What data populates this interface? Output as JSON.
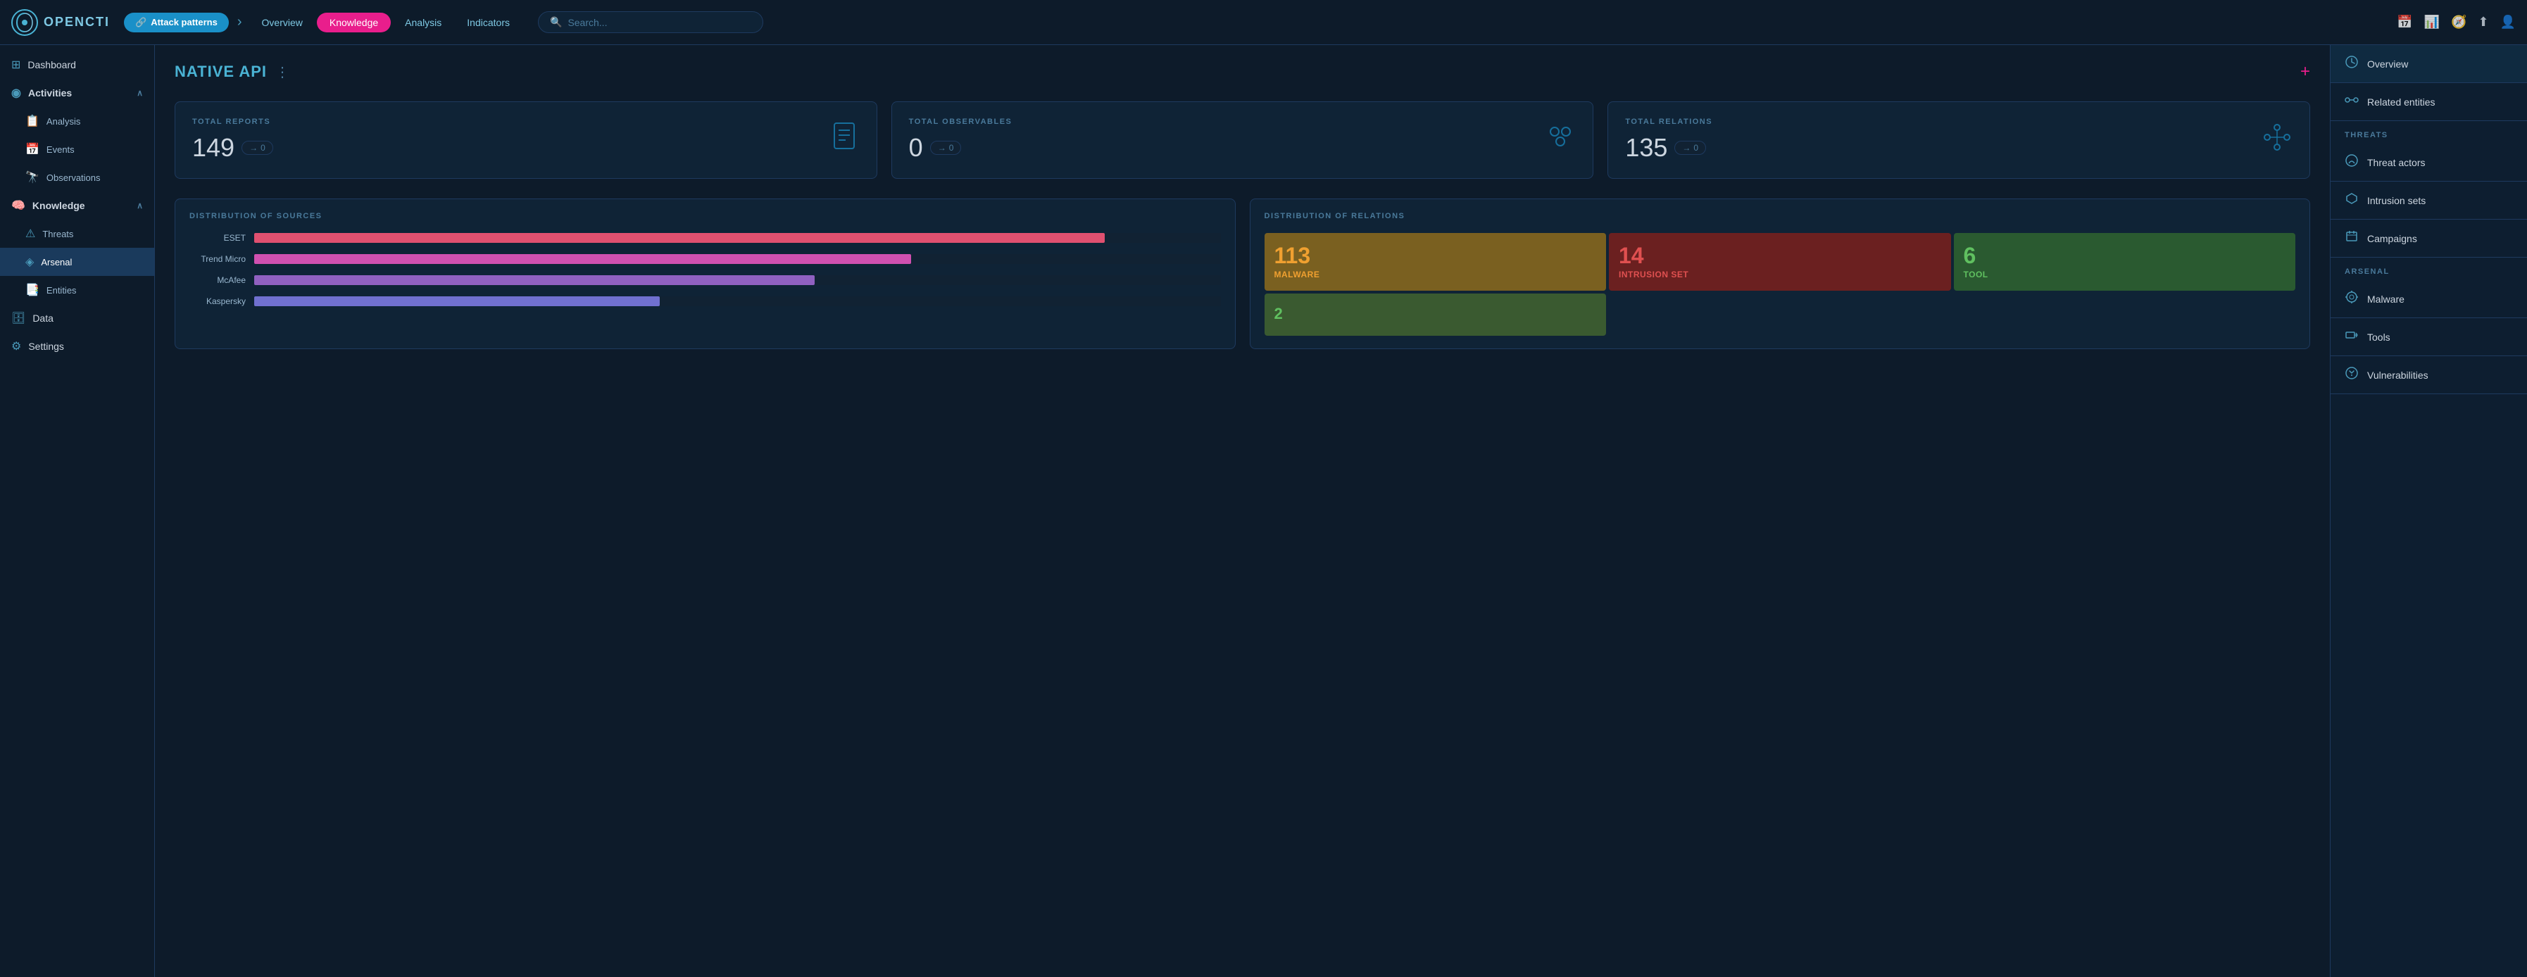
{
  "logo": {
    "text": "OPENCTI"
  },
  "topnav": {
    "breadcrumb_icon": "🔗",
    "breadcrumb_label": "Attack patterns",
    "tabs": [
      {
        "id": "overview",
        "label": "Overview",
        "active": false
      },
      {
        "id": "knowledge",
        "label": "Knowledge",
        "active": true
      },
      {
        "id": "analysis",
        "label": "Analysis",
        "active": false
      },
      {
        "id": "indicators",
        "label": "Indicators",
        "active": false
      }
    ],
    "search_placeholder": "Search...",
    "icons": [
      "📅",
      "📊",
      "🧭",
      "⬆",
      "👤"
    ]
  },
  "sidebar": {
    "items": [
      {
        "id": "dashboard",
        "label": "Dashboard",
        "icon": "⊞",
        "level": "top"
      },
      {
        "id": "activities",
        "label": "Activities",
        "icon": "⚙",
        "level": "top",
        "expanded": true
      },
      {
        "id": "analysis",
        "label": "Analysis",
        "icon": "📋",
        "level": "sub"
      },
      {
        "id": "events",
        "label": "Events",
        "icon": "📅",
        "level": "sub"
      },
      {
        "id": "observations",
        "label": "Observations",
        "icon": "🔭",
        "level": "sub"
      },
      {
        "id": "knowledge",
        "label": "Knowledge",
        "icon": "🧠",
        "level": "top",
        "expanded": true
      },
      {
        "id": "threats",
        "label": "Threats",
        "icon": "⚠",
        "level": "sub"
      },
      {
        "id": "arsenal",
        "label": "Arsenal",
        "icon": "◈",
        "level": "sub",
        "active": true
      },
      {
        "id": "entities",
        "label": "Entities",
        "icon": "📑",
        "level": "sub"
      },
      {
        "id": "data",
        "label": "Data",
        "icon": "🗄",
        "level": "top"
      },
      {
        "id": "settings",
        "label": "Settings",
        "icon": "⚙",
        "level": "top"
      }
    ]
  },
  "main": {
    "title": "NATIVE API",
    "more_label": "⋮",
    "add_label": "+",
    "stats": [
      {
        "id": "reports",
        "label": "TOTAL REPORTS",
        "value": "149",
        "badge": "→ 0",
        "icon": "📄"
      },
      {
        "id": "observables",
        "label": "TOTAL OBSERVABLES",
        "value": "0",
        "badge": "→ 0",
        "icon": "⬡"
      },
      {
        "id": "relations",
        "label": "TOTAL RELATIONS",
        "value": "135",
        "badge": "→ 0",
        "icon": "🔗"
      }
    ],
    "dist_sources": {
      "label": "DISTRIBUTION OF SOURCES",
      "bars": [
        {
          "name": "ESET",
          "pct": 88,
          "color": "#e05070"
        },
        {
          "name": "Trend Micro",
          "pct": 68,
          "color": "#d050b0"
        },
        {
          "name": "McAfee",
          "pct": 58,
          "color": "#9060c0"
        },
        {
          "name": "Kaspersky",
          "pct": 42,
          "color": "#7070d0"
        }
      ]
    },
    "dist_relations": {
      "label": "DISTRIBUTION OF RELATIONS",
      "cells": [
        {
          "id": "malware",
          "value": "113",
          "label": "Malware",
          "type": "malware"
        },
        {
          "id": "intrusion",
          "value": "14",
          "label": "Intrusion Set",
          "type": "intrusion"
        },
        {
          "id": "tool",
          "value": "6",
          "label": "Tool",
          "type": "tool"
        },
        {
          "id": "small",
          "value": "2",
          "label": "",
          "type": "small-val"
        }
      ]
    }
  },
  "right_panel": {
    "sections": [
      {
        "id": "overview-section",
        "items": [
          {
            "id": "overview",
            "label": "Overview",
            "icon": "⏱",
            "active": true
          }
        ]
      },
      {
        "id": "entities-section",
        "items": [
          {
            "id": "related",
            "label": "Related entities",
            "icon": "🔗"
          }
        ]
      },
      {
        "id": "threats-section",
        "header": "Threats",
        "items": [
          {
            "id": "threat-actors",
            "label": "Threat actors",
            "icon": "🌐"
          },
          {
            "id": "intrusion-sets",
            "label": "Intrusion sets",
            "icon": "◇"
          },
          {
            "id": "campaigns",
            "label": "Campaigns",
            "icon": "🏳"
          }
        ]
      },
      {
        "id": "arsenal-section",
        "header": "Arsenal",
        "items": [
          {
            "id": "malware",
            "label": "Malware",
            "icon": "☣"
          },
          {
            "id": "tools",
            "label": "Tools",
            "icon": "🖥"
          },
          {
            "id": "vulnerabilities",
            "label": "Vulnerabilities",
            "icon": "⚙"
          }
        ]
      }
    ]
  }
}
